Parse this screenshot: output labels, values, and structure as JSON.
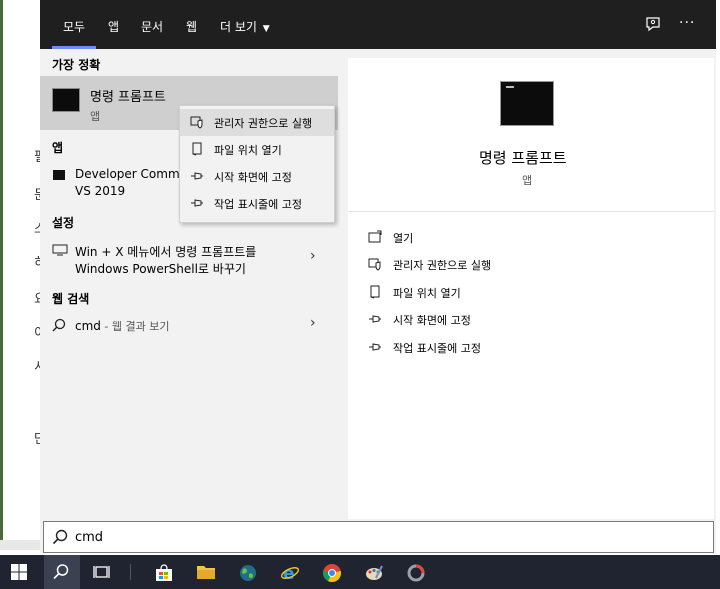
{
  "tabs": [
    "모두",
    "앱",
    "문서",
    "웹",
    "더 보기"
  ],
  "left": {
    "best_match_header": "가장 정확",
    "best_match_title": "명령 프롬프트",
    "best_match_sub": "앱",
    "apps_header": "앱",
    "app_item_line1": "Developer Comm",
    "app_item_line2": "VS 2019",
    "settings_header": "설정",
    "setting_line1": "Win + X 메뉴에서 명령 프롬프트를",
    "setting_line2": "Windows PowerShell로 바꾸기",
    "web_header": "웹 검색",
    "web_query": "cmd",
    "web_suffix": " - 웹 결과 보기"
  },
  "context_menu": [
    {
      "label": "관리자 권한으로 실행",
      "icon": "shield-icon"
    },
    {
      "label": "파일 위치 열기",
      "icon": "folder-location-icon"
    },
    {
      "label": "시작 화면에 고정",
      "icon": "pin-icon"
    },
    {
      "label": "작업 표시줄에 고정",
      "icon": "pin-icon"
    }
  ],
  "right": {
    "title": "명령 프롬프트",
    "sub": "앱",
    "actions": [
      {
        "label": "열기",
        "icon": "open-icon"
      },
      {
        "label": "관리자 권한으로 실행",
        "icon": "shield-icon"
      },
      {
        "label": "파일 위치 열기",
        "icon": "folder-location-icon"
      },
      {
        "label": "시작 화면에 고정",
        "icon": "pin-icon"
      },
      {
        "label": "작업 표시줄에 고정",
        "icon": "pin-icon"
      }
    ]
  },
  "search": {
    "value": "cmd"
  },
  "background_chars": [
    "필",
    "문",
    "스",
    "히",
    "요",
    "이",
    "시",
    "단"
  ],
  "colors": {
    "topbar": "#1f1f1f",
    "accent": "#6a8cff",
    "selected_row": "#cfcfcf",
    "taskbar": "#1f2430"
  }
}
